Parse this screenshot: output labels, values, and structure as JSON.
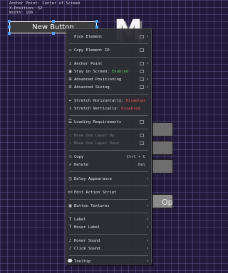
{
  "info": {
    "line1": "Anchor Point: Center of Screen",
    "line2": "X-Position: 32",
    "line3": "Width: 108"
  },
  "element": {
    "label": "New Button"
  },
  "background": {
    "title_fragment": "M",
    "button_label": "Op"
  },
  "menu": {
    "pick_element": "Pick Element",
    "copy_element_id": "Copy Element ID",
    "anchor_point": "Anchor Point",
    "stay_on_screen": "Stay on Screen:",
    "stay_on_screen_value": "Enabled",
    "advanced_positioning": "Advanced Positioning",
    "advanced_sizing": "Advanced Sizing",
    "stretch_horizontally": "Stretch Horizontally:",
    "stretch_horizontally_value": "Disabled",
    "stretch_vertically": "Stretch Vertically:",
    "stretch_vertically_value": "Disabled",
    "loading_requirements": "Loading Requirements",
    "move_up": "Move One Layer Up",
    "move_down": "Move One Layer Down",
    "copy": "Copy",
    "copy_shortcut": "Ctrl + C",
    "delete": "Delete",
    "delete_shortcut": "Del",
    "delay_appearance": "Delay Appearance",
    "edit_action_script": "Edit Action Script",
    "button_textures": "Button Textures",
    "label": "Label",
    "hover_label": "Hover Label",
    "hover_sound": "Hover Sound",
    "click_sound": "Click Sound",
    "tooltip": "Tooltip"
  },
  "colors": {
    "enabled": "#58d158",
    "disabled": "#ff5555",
    "selection": "#4aa3ff"
  }
}
